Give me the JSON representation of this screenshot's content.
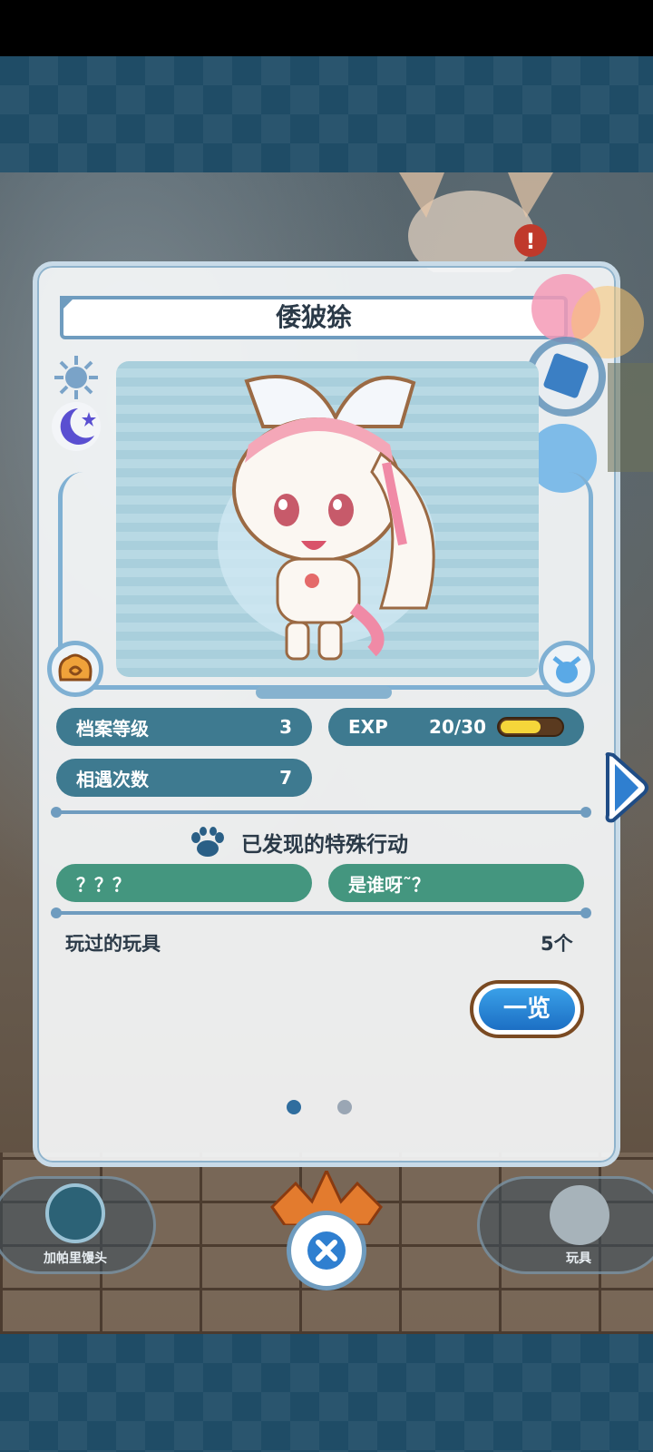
{
  "character": {
    "name": "倭狓狳"
  },
  "stats": {
    "file_level_label": "档案等级",
    "file_level_value": "3",
    "exp_label": "EXP",
    "exp_value": "20/30",
    "exp_progress": 0.67,
    "encounters_label": "相遇次数",
    "encounters_value": "7"
  },
  "special_actions": {
    "title": "已发现的特殊行动",
    "items": [
      "？？？",
      "是谁呀˜？"
    ]
  },
  "toys": {
    "label": "玩过的玩具",
    "count": "5个",
    "list_button": "一览"
  },
  "pagination": {
    "pages": 2,
    "current": 1
  },
  "bottom_nav": {
    "left_label": "加帕里馒头",
    "right_label": "玩具"
  },
  "icons": {
    "sun": "sun-icon",
    "moon": "moon-icon",
    "paw": "paw-icon",
    "close": "close-icon",
    "next": "chevron-right-icon"
  },
  "colors": {
    "pill_blue": "#3e7a90",
    "pill_green": "#44967f",
    "exp_fill": "#f5d63a",
    "accent": "#1c6fc4"
  }
}
